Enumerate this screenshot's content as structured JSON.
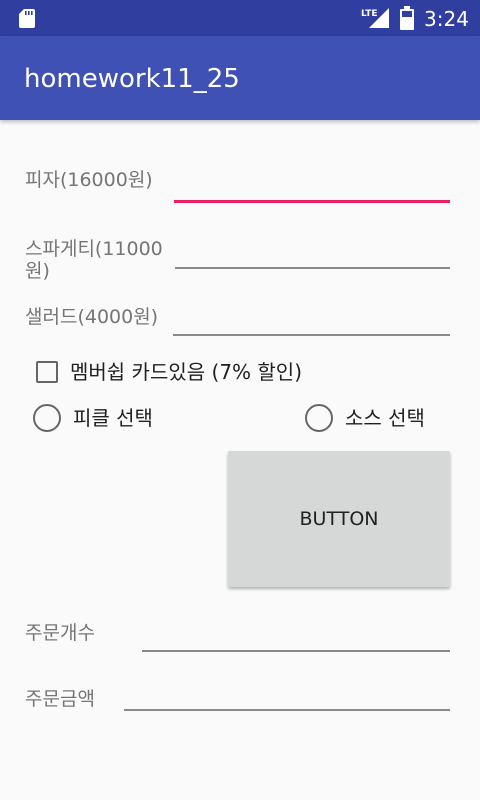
{
  "status_bar": {
    "network_label": "LTE",
    "time": "3:24"
  },
  "app_bar": {
    "title": "homework11_25"
  },
  "form": {
    "pizza_label": "피자(16000원)",
    "spaghetti_label_line1": "스파게티(11000",
    "spaghetti_label_line2": "원)",
    "salad_label": "샐러드(4000원)",
    "membership_checkbox_label": "멤버쉽 카드있음 (7% 할인)",
    "pickle_radio_label": "피클 선택",
    "sauce_radio_label": "소스 선택",
    "button_label": "BUTTON",
    "order_count_label": "주문개수",
    "order_amount_label": "주문금액"
  },
  "colors": {
    "status_bar": "#303f9f",
    "app_bar": "#3f51b5",
    "accent": "#e91e63"
  },
  "icons": [
    "sd-card-icon",
    "lte-signal-icon",
    "battery-icon"
  ]
}
